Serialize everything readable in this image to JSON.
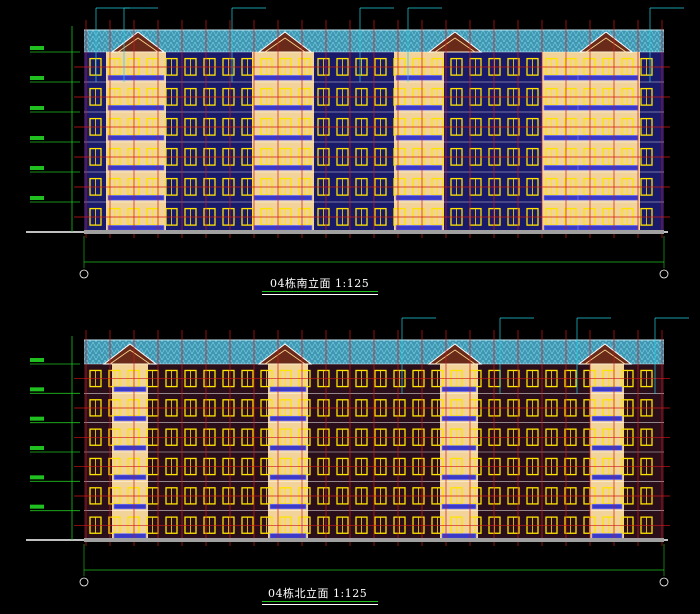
{
  "drawing": {
    "south": {
      "title": "04栋南立面 1:125"
    },
    "north": {
      "title": "04栋北立面 1:125"
    }
  },
  "colors": {
    "background": "#000000",
    "roof": "#4fb0c8",
    "wall": "#f2d39a",
    "window": "#ffe400",
    "balcony": "#3a3ac8",
    "grid": "#d01818",
    "dim": "#20c020",
    "leader": "#20d0e0"
  }
}
